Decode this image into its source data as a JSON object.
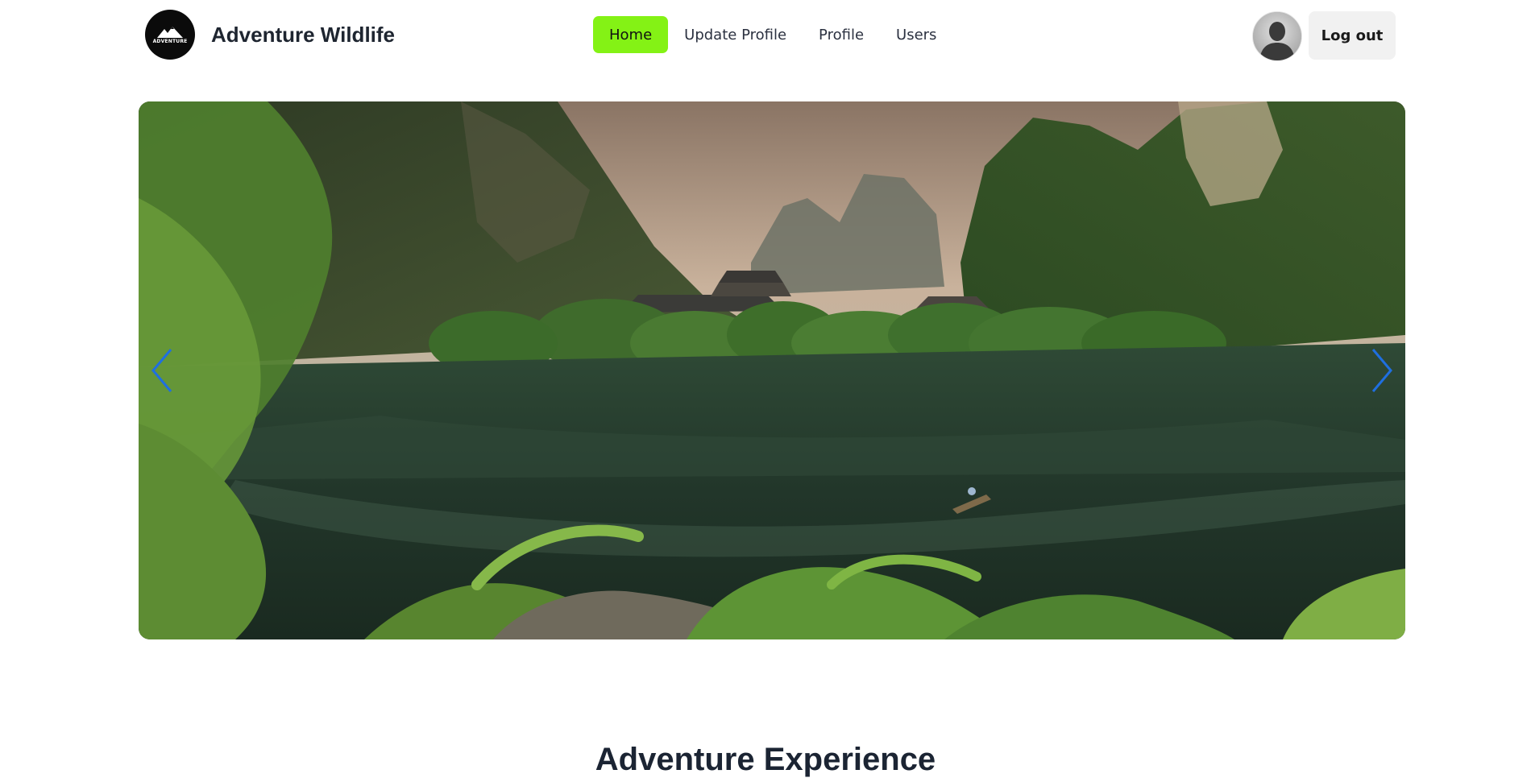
{
  "brand": {
    "name": "Adventure Wildlife",
    "logo_text": "ADVENTURE",
    "logo_icon": "mountain-icon"
  },
  "nav": {
    "items": [
      {
        "label": "Home",
        "active": true
      },
      {
        "label": "Update Profile",
        "active": false
      },
      {
        "label": "Profile",
        "active": false
      },
      {
        "label": "Users",
        "active": false
      }
    ]
  },
  "user": {
    "avatar_icon": "user-silhouette-icon",
    "logout_label": "Log out"
  },
  "carousel": {
    "image_alt": "Temple by a lake surrounded by karst mountains",
    "prev_icon": "chevron-left-icon",
    "next_icon": "chevron-right-icon"
  },
  "section": {
    "title": "Adventure Experience"
  },
  "colors": {
    "accent": "#84f215",
    "arrow": "#1f6fe0",
    "heading": "#1b2433"
  }
}
